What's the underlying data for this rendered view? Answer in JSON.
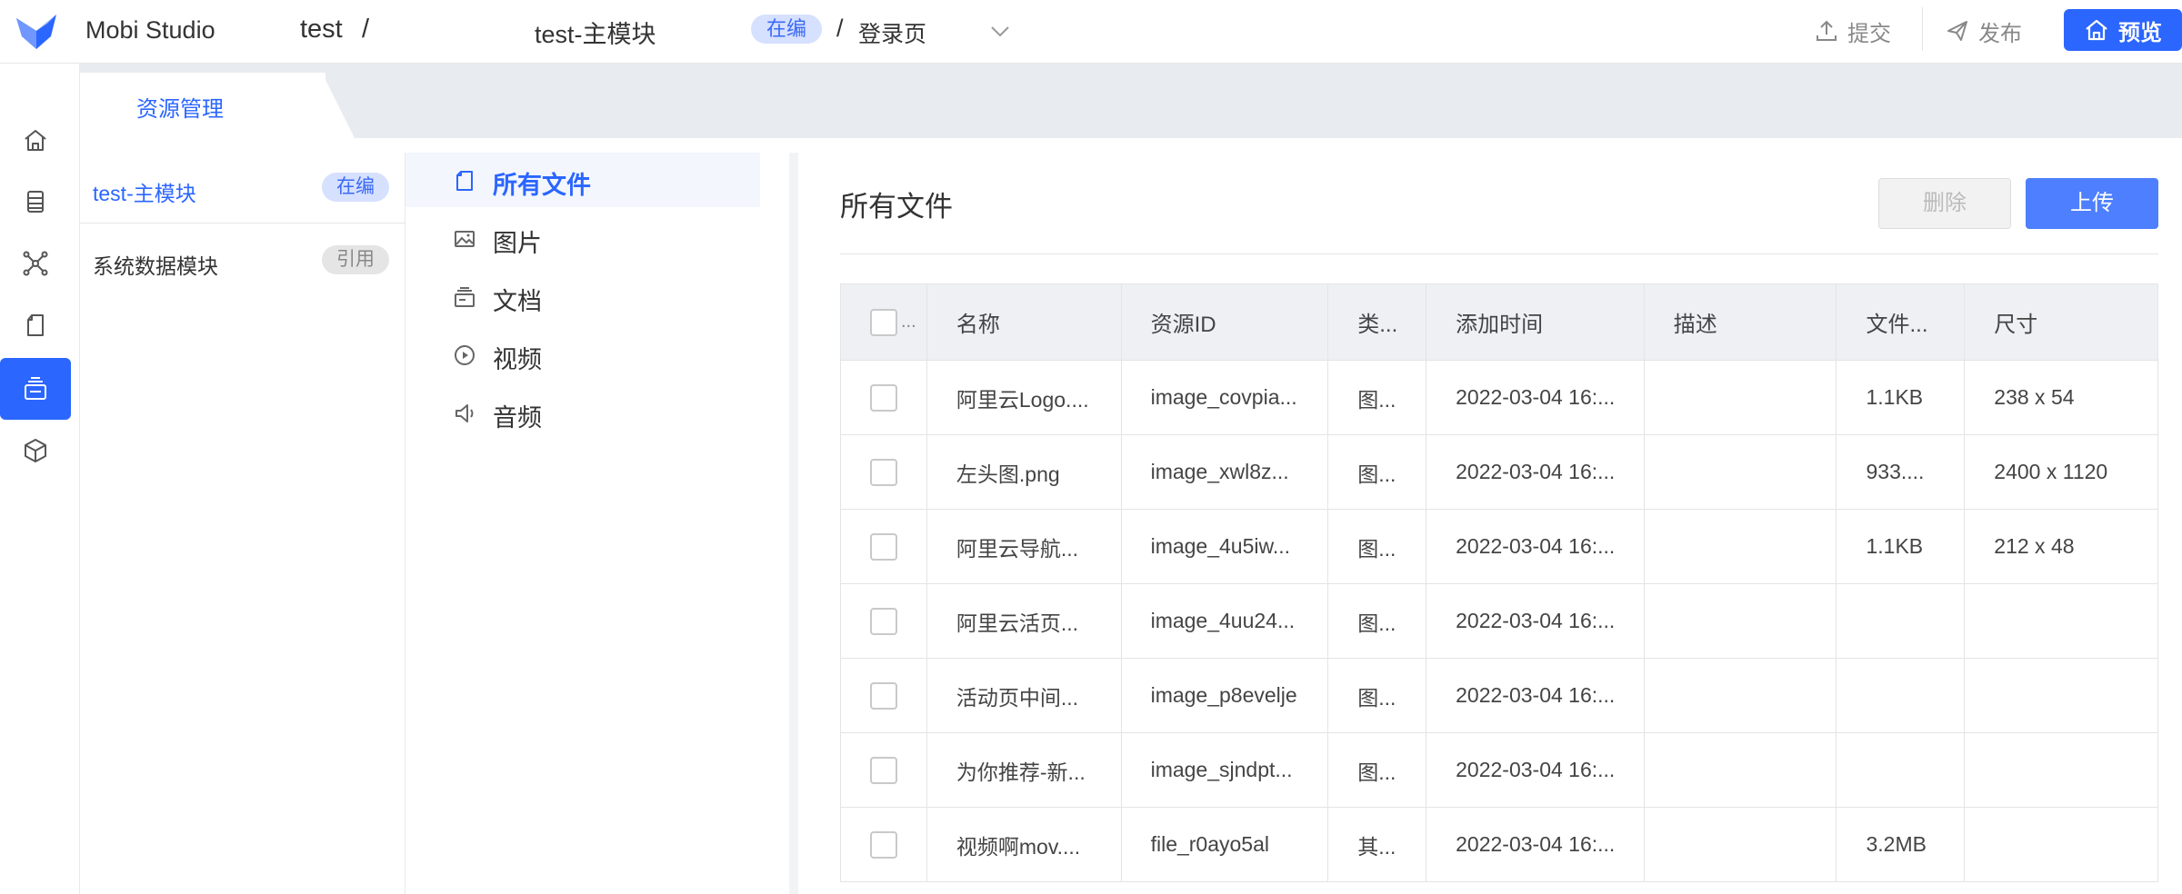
{
  "header": {
    "app_name": "Mobi Studio",
    "project": "test",
    "separator": "/",
    "module": "test-主模块",
    "status_tag": "在编",
    "page_separator": "/",
    "page": "登录页",
    "submit_label": "提交",
    "publish_label": "发布",
    "preview_label": "预览"
  },
  "rail": {
    "items": [
      {
        "icon": "home-icon",
        "active": false
      },
      {
        "icon": "database-icon",
        "active": false
      },
      {
        "icon": "nodes-icon",
        "active": false
      },
      {
        "icon": "page-icon",
        "active": false
      },
      {
        "icon": "resource-icon",
        "active": true
      },
      {
        "icon": "cube-icon",
        "active": false
      }
    ]
  },
  "tabs": [
    {
      "label": "资源管理",
      "active": true
    }
  ],
  "modules": [
    {
      "label": "test-主模块",
      "badge": "在编",
      "active": true
    },
    {
      "label": "系统数据模块",
      "badge": "引用",
      "active": false
    }
  ],
  "categories": [
    {
      "label": "所有文件",
      "icon": "file-icon",
      "active": true
    },
    {
      "label": "图片",
      "icon": "image-icon",
      "active": false
    },
    {
      "label": "文档",
      "icon": "document-icon",
      "active": false
    },
    {
      "label": "视频",
      "icon": "video-icon",
      "active": false
    },
    {
      "label": "音频",
      "icon": "audio-icon",
      "active": false
    }
  ],
  "main": {
    "title": "所有文件",
    "delete_label": "删除",
    "upload_label": "上传"
  },
  "table": {
    "select_all_suffix": "...",
    "columns": [
      "名称",
      "资源ID",
      "类...",
      "添加时间",
      "描述",
      "文件...",
      "尺寸"
    ],
    "rows": [
      {
        "name": "阿里云Logo....",
        "id": "image_covpia...",
        "type": "图...",
        "time": "2022-03-04 16:...",
        "desc": "",
        "size": "1.1KB",
        "dims": "238 x 54"
      },
      {
        "name": "左头图.png",
        "id": "image_xwl8z...",
        "type": "图...",
        "time": "2022-03-04 16:...",
        "desc": "",
        "size": "933....",
        "dims": "2400 x 1120"
      },
      {
        "name": "阿里云导航...",
        "id": "image_4u5iw...",
        "type": "图...",
        "time": "2022-03-04 16:...",
        "desc": "",
        "size": "1.1KB",
        "dims": "212 x 48"
      },
      {
        "name": "阿里云活页...",
        "id": "image_4uu24...",
        "type": "图...",
        "time": "2022-03-04 16:...",
        "desc": "",
        "size": "",
        "dims": ""
      },
      {
        "name": "活动页中间...",
        "id": "image_p8evelje",
        "type": "图...",
        "time": "2022-03-04 16:...",
        "desc": "",
        "size": "",
        "dims": ""
      },
      {
        "name": "为你推荐-新...",
        "id": "image_sjndpt...",
        "type": "图...",
        "time": "2022-03-04 16:...",
        "desc": "",
        "size": "",
        "dims": ""
      },
      {
        "name": "视频啊mov....",
        "id": "file_r0ayo5al",
        "type": "其...",
        "time": "2022-03-04 16:...",
        "desc": "",
        "size": "3.2MB",
        "dims": ""
      }
    ]
  },
  "colors": {
    "primary": "#2b66ff",
    "upload": "#4d7ffe",
    "tag_bg": "#d6e0ff",
    "header_bg": "#eef0f4"
  }
}
